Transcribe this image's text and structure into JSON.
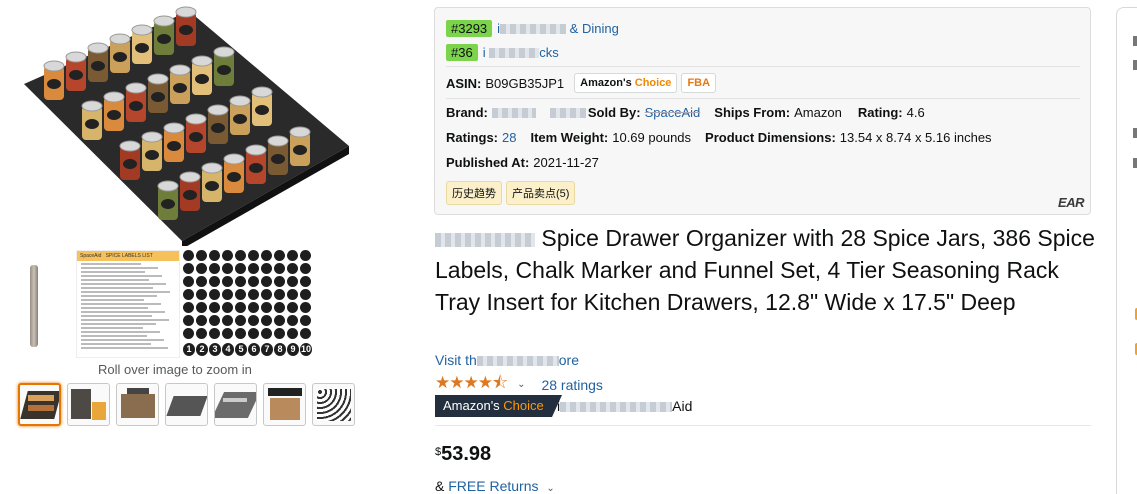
{
  "images": {
    "roll_over_text": "Roll over image to zoom in",
    "label_sheet_brand": "SpaceAid",
    "label_sheet_title": "SPICE LABELS LIST",
    "number_labels": [
      "1",
      "2",
      "3",
      "4",
      "5",
      "6",
      "7",
      "8",
      "9",
      "10"
    ],
    "thumbnail_count": 7
  },
  "extension": {
    "ranks": [
      {
        "badge": "#3293",
        "category": "& Dining"
      },
      {
        "badge": "#36",
        "category": "cks"
      }
    ],
    "asin_label": "ASIN:",
    "asin_value": "B09GB35JP1",
    "choice_badge_a": "Amazon's",
    "choice_badge_b": "Choice",
    "fba_badge": "FBA",
    "brand_label": "Brand:",
    "sold_by_label": "Sold By:",
    "sold_by_value": "SpaceAid",
    "ships_from_label": "Ships From:",
    "ships_from_value": "Amazon",
    "rating_label": "Rating:",
    "rating_value": "4.6",
    "ratings_label": "Ratings:",
    "ratings_value": "28",
    "weight_label": "Item Weight:",
    "weight_value": "10.69 pounds",
    "dims_label": "Product Dimensions:",
    "dims_value": "13.54 x 8.74 x 5.16 inches",
    "published_label": "Published At:",
    "published_value": "2021-11-27",
    "history_button": "历史趋势",
    "selling_points_button": "产品卖点(5)",
    "logo_text": "EAR"
  },
  "product": {
    "title": "pice Drawer Organizer with 28 Spice Jars, 386 Spice Labels, Chalk Marker and Funnel Set, 4 Tier Seasoning Rack Tray Insert for Kitchen Drawers, 12.8\" Wide x 17.5\" Deep",
    "store_prefix": "Visit th",
    "store_suffix": "ore",
    "stars_glyph": "★★★★⯪",
    "ratings_link": "28 ratings",
    "choice_a": "Amazon's",
    "choice_b": "Choice",
    "choice_for_prefix": "i",
    "choice_for_suffix": "Aid",
    "price_symbol": "$",
    "price_amount": "53.98",
    "returns_prefix": "&",
    "returns_link": "FREE Returns"
  }
}
